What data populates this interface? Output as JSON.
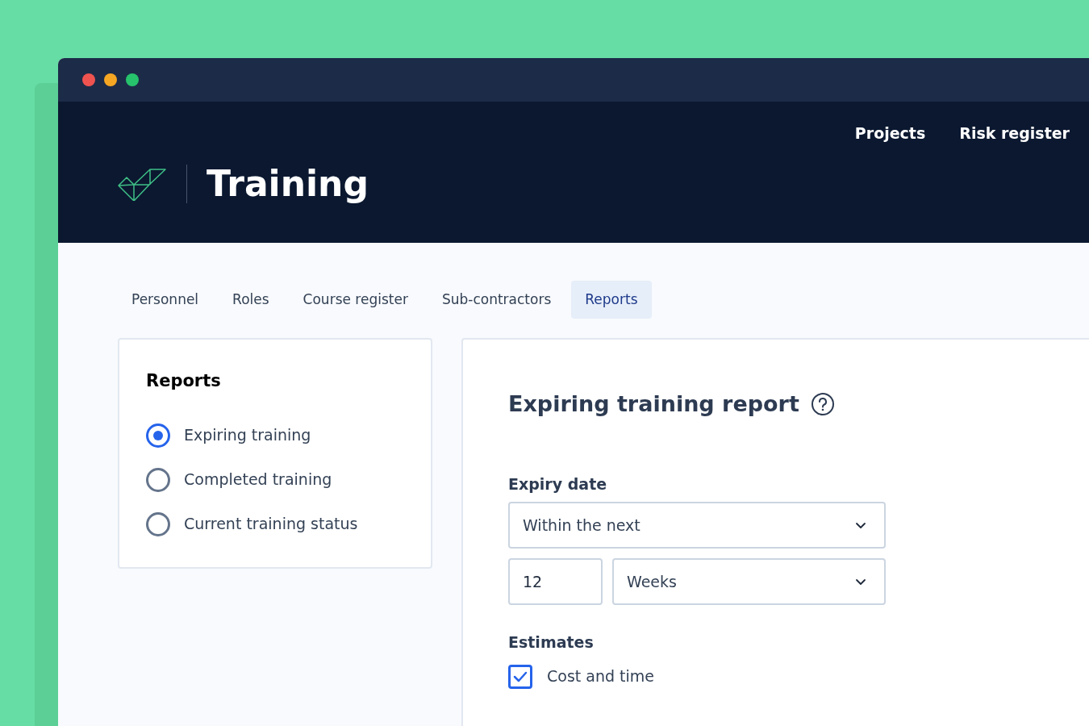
{
  "window": {
    "controls": [
      {
        "color": "#ef5350"
      },
      {
        "color": "#f5a623"
      },
      {
        "color": "#27c26c"
      }
    ]
  },
  "header": {
    "title": "Training",
    "nav": [
      "Projects",
      "Risk register"
    ]
  },
  "tabs": [
    {
      "label": "Personnel",
      "selected": false
    },
    {
      "label": "Roles",
      "selected": false
    },
    {
      "label": "Course register",
      "selected": false
    },
    {
      "label": "Sub-contractors",
      "selected": false
    },
    {
      "label": "Reports",
      "selected": true
    }
  ],
  "sidebar": {
    "title": "Reports",
    "options": [
      {
        "label": "Expiring training",
        "selected": true
      },
      {
        "label": "Completed training",
        "selected": false
      },
      {
        "label": "Current training status",
        "selected": false
      }
    ]
  },
  "report": {
    "title": "Expiring training report",
    "expiry_label": "Expiry date",
    "range_select": "Within the next",
    "amount": "12",
    "unit_select": "Weeks",
    "estimates_label": "Estimates",
    "estimates": [
      {
        "label": "Cost and time",
        "checked": true
      }
    ]
  }
}
